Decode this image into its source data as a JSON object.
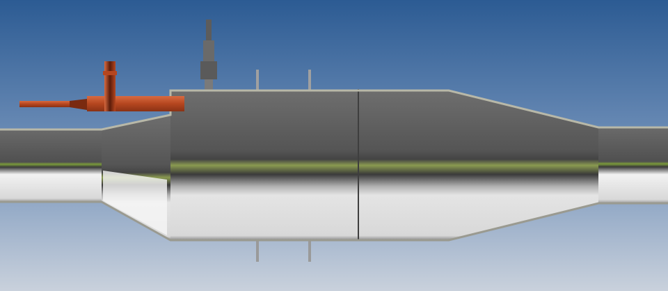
{
  "colors": {
    "sky_top": "#2c5b93",
    "sky_bottom": "#c9d1dc",
    "pipe_dark": "#585858",
    "pipe_light": "#e6e6e6",
    "weld_green": "#6b8a2a",
    "copper": "#c0502a",
    "sensor": "#6a6a6a"
  }
}
